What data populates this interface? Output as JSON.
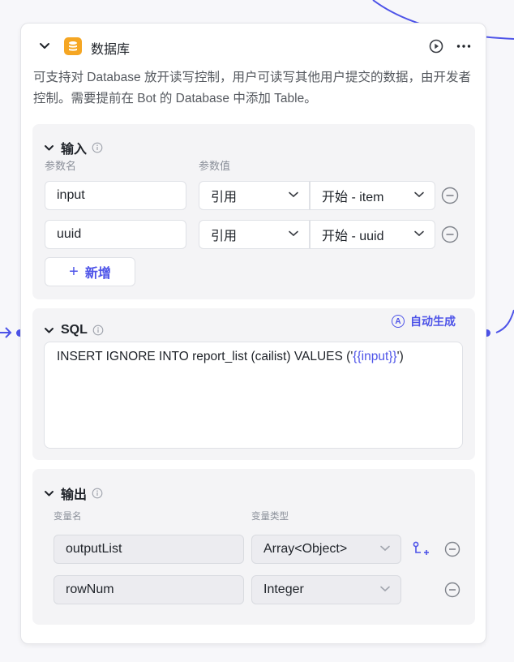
{
  "node": {
    "title": "数据库",
    "icon": "database-icon",
    "description": "可支持对 Database 放开读写控制，用户可读写其他用户提交的数据，由开发者控制。需要提前在 Bot 的 Database 中添加 Table。"
  },
  "input": {
    "title": "输入",
    "col_name": "参数名",
    "col_value": "参数值",
    "rows": [
      {
        "name": "input",
        "type": "引用",
        "value": "开始 - item"
      },
      {
        "name": "uuid",
        "type": "引用",
        "value": "开始 - uuid"
      }
    ],
    "add_label": "新增"
  },
  "sql": {
    "title": "SQL",
    "auto_label": "自动生成",
    "auto_letter": "A",
    "query_prefix": "INSERT IGNORE INTO report_list (cailist) VALUES ('",
    "query_var": "{{input}}",
    "query_suffix": "')"
  },
  "output": {
    "title": "输出",
    "col_name": "变量名",
    "col_type": "变量类型",
    "rows": [
      {
        "name": "outputList",
        "type": "Array<Object>"
      },
      {
        "name": "rowNum",
        "type": "Integer"
      }
    ]
  },
  "colors": {
    "accent": "#4d53e8",
    "db_icon": "#f5a623"
  }
}
